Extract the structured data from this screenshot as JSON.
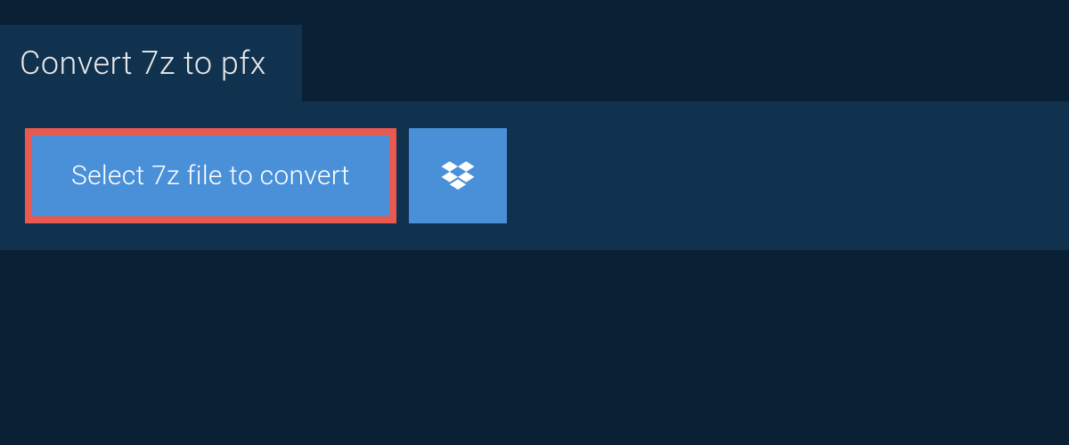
{
  "header": {
    "title": "Convert 7z to pfx"
  },
  "actions": {
    "select_file_label": "Select 7z file to convert",
    "dropbox_icon_name": "dropbox-icon"
  },
  "colors": {
    "background": "#0a2034",
    "panel": "#11324f",
    "button_primary": "#4a90d9",
    "button_highlight_border": "#e85a4f",
    "text_light": "#e8e8e8"
  }
}
